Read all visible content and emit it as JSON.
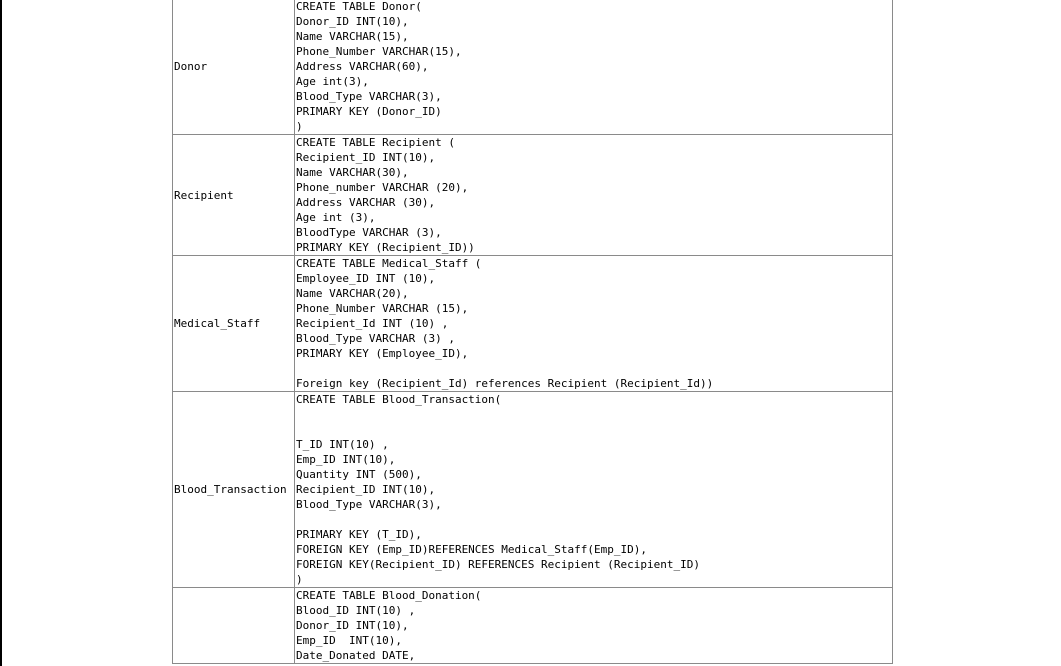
{
  "tables": [
    {
      "name": "Donor",
      "sql": [
        "CREATE TABLE Donor(",
        "Donor_ID INT(10),",
        "Name VARCHAR(15),",
        "Phone_Number VARCHAR(15),",
        "Address VARCHAR(60),",
        "Age int(3),",
        "Blood_Type VARCHAR(3),",
        "PRIMARY KEY (Donor_ID)",
        ")"
      ]
    },
    {
      "name": "Recipient",
      "sql": [
        "CREATE TABLE Recipient (",
        "Recipient_ID INT(10),",
        "Name VARCHAR(30),",
        "Phone_number VARCHAR (20),",
        "Address VARCHAR (30),",
        "Age int (3),",
        "BloodType VARCHAR (3),",
        "PRIMARY KEY (Recipient_ID))"
      ]
    },
    {
      "name": "Medical_Staff",
      "sql": [
        "CREATE TABLE Medical_Staff (",
        "Employee_ID INT (10),",
        "Name VARCHAR(20),",
        "Phone_Number VARCHAR (15),",
        "Recipient_Id INT (10) ,",
        "Blood_Type VARCHAR (3) ,",
        "PRIMARY KEY (Employee_ID),",
        "",
        "Foreign key (Recipient_Id) references Recipient (Recipient_Id))"
      ]
    },
    {
      "name": "Blood_Transaction",
      "sql": [
        "CREATE TABLE Blood_Transaction(",
        "",
        "",
        "T_ID INT(10) ,",
        "Emp_ID INT(10),",
        "Quantity INT (500),",
        "Recipient_ID INT(10),",
        "Blood_Type VARCHAR(3),",
        "",
        "PRIMARY KEY (T_ID),",
        "FOREIGN KEY (Emp_ID)REFERENCES Medical_Staff(Emp_ID),",
        "FOREIGN KEY(Recipient_ID) REFERENCES Recipient (Recipient_ID)",
        ")"
      ]
    },
    {
      "name": "",
      "sql": [
        "CREATE TABLE Blood_Donation(",
        "Blood_ID INT(10) ,",
        "Donor_ID INT(10),",
        "Emp_ID  INT(10),",
        "Date_Donated DATE,"
      ]
    }
  ]
}
